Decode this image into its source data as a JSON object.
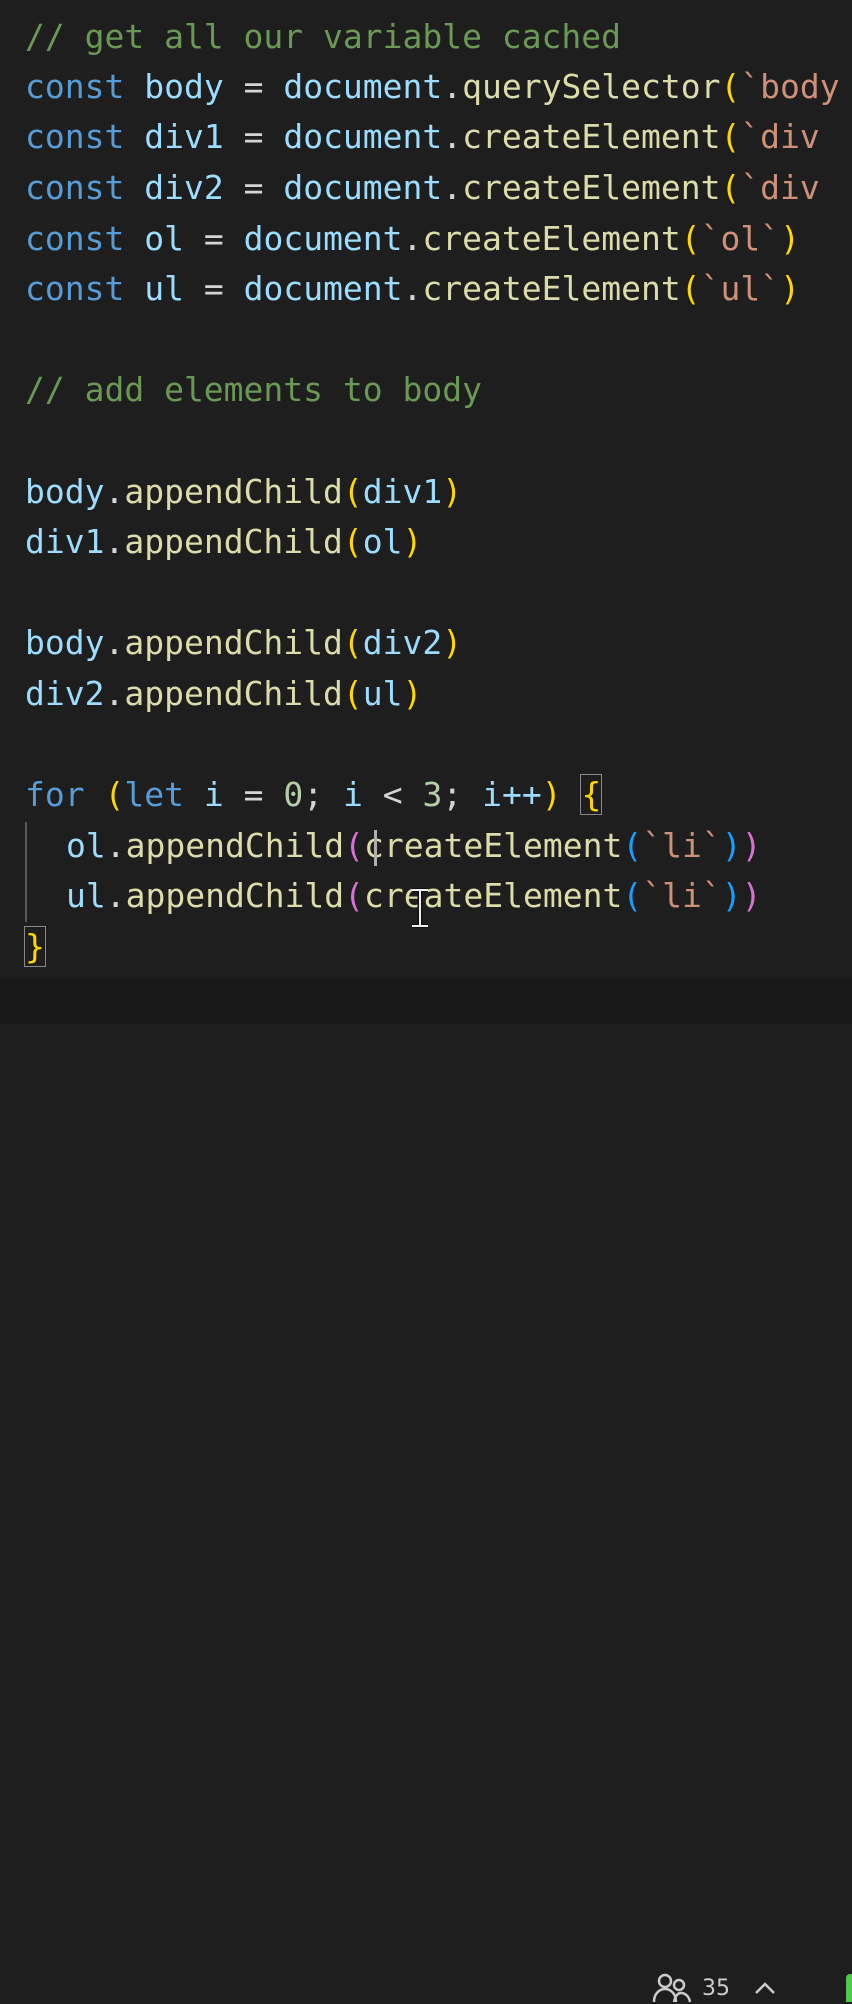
{
  "editor": {
    "lines": {
      "c1": "// get all our variable cached",
      "l1": {
        "kw": "const",
        "name": "body",
        "eq": "=",
        "obj": "document",
        "dot": ".",
        "fn": "querySelector",
        "open": "(",
        "str": "`body"
      },
      "l2": {
        "kw": "const",
        "name": "div1",
        "eq": "=",
        "obj": "document",
        "dot": ".",
        "fn": "createElement",
        "open": "(",
        "str": "`div"
      },
      "l3": {
        "kw": "const",
        "name": "div2",
        "eq": "=",
        "obj": "document",
        "dot": ".",
        "fn": "createElement",
        "open": "(",
        "str": "`div"
      },
      "l4": {
        "kw": "const",
        "name": "ol",
        "eq": "=",
        "obj": "document",
        "dot": ".",
        "fn": "createElement",
        "open": "(",
        "str": "`ol`",
        "close": ")"
      },
      "l5": {
        "kw": "const",
        "name": "ul",
        "eq": "=",
        "obj": "document",
        "dot": ".",
        "fn": "createElement",
        "open": "(",
        "str": "`ul`",
        "close": ")"
      },
      "c2": "// add elements to body",
      "a1": {
        "obj": "body",
        "dot": ".",
        "fn": "appendChild",
        "open": "(",
        "arg": "div1",
        "close": ")"
      },
      "a2": {
        "obj": "div1",
        "dot": ".",
        "fn": "appendChild",
        "open": "(",
        "arg": "ol",
        "close": ")"
      },
      "a3": {
        "obj": "body",
        "dot": ".",
        "fn": "appendChild",
        "open": "(",
        "arg": "div2",
        "close": ")"
      },
      "a4": {
        "obj": "div2",
        "dot": ".",
        "fn": "appendChild",
        "open": "(",
        "arg": "ul",
        "close": ")"
      },
      "f1": {
        "kw": "for",
        "open": "(",
        "let": "let",
        "i": "i",
        "eq": "=",
        "zero": "0",
        "semi": ";",
        "i2": "i",
        "lt": "<",
        "three": "3",
        "semi2": ";",
        "inc": "i++",
        "close": ")",
        "brace": "{"
      },
      "f2": {
        "obj": "ol",
        "dot": ".",
        "fn": "appendChild",
        "open": "(",
        "fn2": "createElement",
        "open2": "(",
        "str": "`li`",
        "close2": ")",
        "close": ")"
      },
      "f3": {
        "obj": "ul",
        "dot": ".",
        "fn": "appendChild",
        "open": "(",
        "fn2": "createElement",
        "open2": "(",
        "str": "`li`",
        "close2": ")",
        "close": ")"
      },
      "f4": "}"
    }
  },
  "statusbar": {
    "collaborators_icon": "people-icon",
    "collaborators_count": "35",
    "expand_icon": "chevron-up-icon"
  },
  "colors": {
    "background": "#1e1e1e",
    "comment": "#6a9955",
    "keyword": "#569cd6",
    "variable": "#9cdcfe",
    "function": "#dcdcaa",
    "string": "#ce9178",
    "bracket_level1": "#ffd700",
    "bracket_level2": "#da70d6",
    "bracket_level3": "#179fff",
    "accent_green": "#4ec94e"
  }
}
